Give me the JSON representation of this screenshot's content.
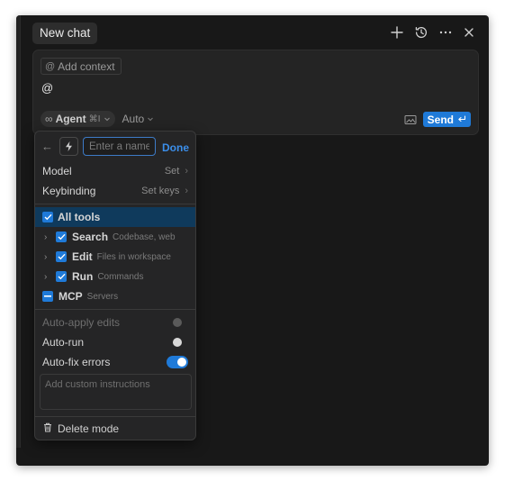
{
  "header": {
    "tab_label": "New chat",
    "icons": [
      "plus-icon",
      "history-icon",
      "more-icon",
      "close-icon"
    ]
  },
  "composer": {
    "add_context_label": "Add context",
    "input_value": "@",
    "mode_label": "Agent",
    "mode_shortcut": "⌘I",
    "model_label": "Auto",
    "send_label": "Send"
  },
  "mode_editor": {
    "name_placeholder": "Enter a name",
    "done_label": "Done",
    "settings": [
      {
        "label": "Model",
        "value": "Set"
      },
      {
        "label": "Keybinding",
        "value": "Set keys"
      }
    ],
    "all_tools_label": "All tools",
    "tools": [
      {
        "name": "Search",
        "description": "Codebase, web"
      },
      {
        "name": "Edit",
        "description": "Files in workspace"
      },
      {
        "name": "Run",
        "description": "Commands"
      }
    ],
    "mcp": {
      "name": "MCP",
      "description": "Servers"
    },
    "toggles": [
      {
        "label": "Auto-apply edits",
        "state": "disabled"
      },
      {
        "label": "Auto-run",
        "state": "off"
      },
      {
        "label": "Auto-fix errors",
        "state": "on"
      }
    ],
    "instructions_placeholder": "Add custom instructions",
    "delete_label": "Delete mode"
  },
  "colors": {
    "accent": "#1f7ad8",
    "background": "#181818",
    "panel": "#252526"
  }
}
